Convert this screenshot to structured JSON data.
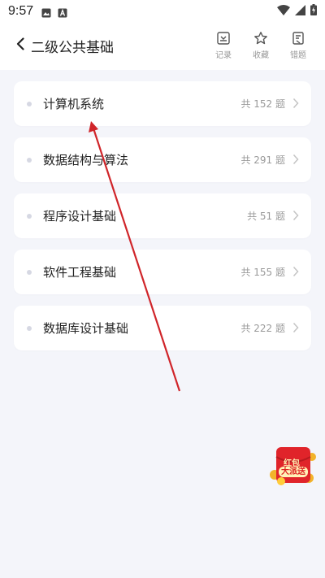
{
  "status": {
    "time": "9:57"
  },
  "header": {
    "title": "二级公共基础",
    "tools": [
      {
        "label": "记录",
        "icon": "record-icon"
      },
      {
        "label": "收藏",
        "icon": "star-icon"
      },
      {
        "label": "错题",
        "icon": "wrong-questions-icon"
      }
    ]
  },
  "list": [
    {
      "title": "计算机系统",
      "count": "共 152 题"
    },
    {
      "title": "数据结构与算法",
      "count": "共 291 题"
    },
    {
      "title": "程序设计基础",
      "count": "共 51 题"
    },
    {
      "title": "软件工程基础",
      "count": "共 155 题"
    },
    {
      "title": "数据库设计基础",
      "count": "共 222 题"
    }
  ],
  "redpack": {
    "line1": "红包",
    "line2": "大派送"
  },
  "colors": {
    "background": "#f4f5fa",
    "card": "#ffffff",
    "annotation_arrow": "#d0252a",
    "redpack": "#e0242a"
  }
}
